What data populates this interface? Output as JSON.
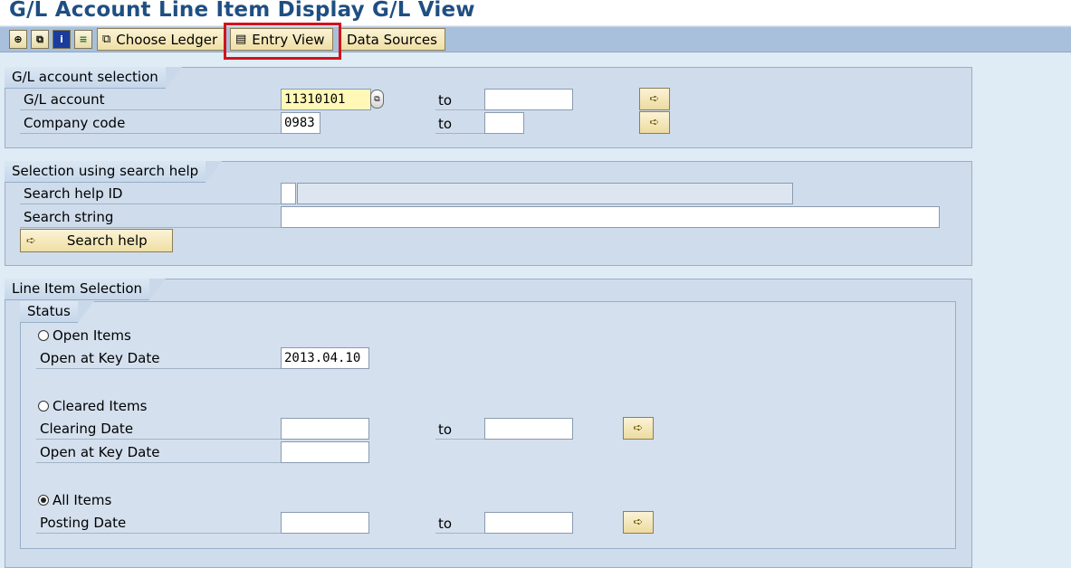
{
  "window": {
    "title": "G/L Account Line Item Display G/L View"
  },
  "toolbar": {
    "icons": [
      {
        "name": "execute-icon",
        "glyph": "⊕"
      },
      {
        "name": "variant-icon",
        "glyph": "⧉"
      },
      {
        "name": "info-icon",
        "glyph": "i"
      },
      {
        "name": "dynamic-selection-icon",
        "glyph": "≡"
      }
    ],
    "choose_ledger": "Choose Ledger",
    "entry_view": "Entry View",
    "data_sources": "Data Sources"
  },
  "gl_selection": {
    "title": "G/L account selection",
    "gl_account_label": "G/L account",
    "gl_account_value": "11310101",
    "company_code_label": "Company code",
    "company_code_value": "0983",
    "to_label": "to"
  },
  "search_help": {
    "title": "Selection using search help",
    "search_help_id_label": "Search help ID",
    "search_string_label": "Search string",
    "button_label": "Search help"
  },
  "line_items": {
    "title": "Line Item Selection",
    "status_title": "Status",
    "open_items_label": "Open Items",
    "open_key_date_label": "Open at Key Date",
    "open_key_date_value": "2013.04.10",
    "cleared_items_label": "Cleared Items",
    "clearing_date_label": "Clearing Date",
    "cleared_key_date_label": "Open at Key Date",
    "all_items_label": "All Items",
    "posting_date_label": "Posting Date",
    "to_label": "to",
    "selected": "All Items"
  },
  "colors": {
    "title": "#1f4f82",
    "highlight": "#d0141b",
    "active_field": "#fff8b6"
  }
}
